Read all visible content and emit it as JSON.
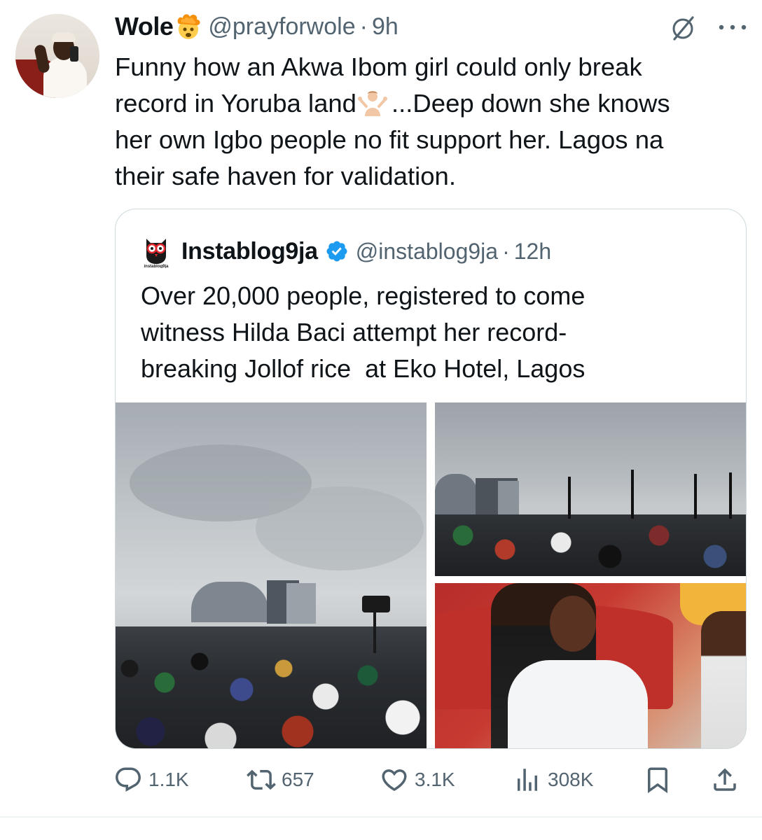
{
  "tweet": {
    "author_name": "Wole",
    "author_emoji": "exploding-head",
    "handle": "@prayforwole",
    "separator": "·",
    "time": "9h",
    "text_lines": [
      "Funny how an Akwa Ibom girl could only break",
      "record in Yoruba land",
      "...Deep down she knows",
      "her own Igbo people no fit support her. Lagos na",
      "their safe haven for validation."
    ]
  },
  "quoted": {
    "author_name": "Instablog9ja",
    "verified": true,
    "handle": "@instablog9ja",
    "separator": "·",
    "time": "12h",
    "text_lines": [
      "Over 20,000 people, registered to come",
      "witness Hilda Baci attempt her record-",
      "breaking Jollof rice  at Eko Hotel, Lagos"
    ],
    "logo_text": "instablog9ja"
  },
  "actions": {
    "replies": "1.1K",
    "retweets": "657",
    "likes": "3.1K",
    "views": "308K"
  },
  "colors": {
    "text": "#0f1419",
    "secondary": "#536471",
    "border": "#cfd9de",
    "verified": "#1d9bf0"
  }
}
